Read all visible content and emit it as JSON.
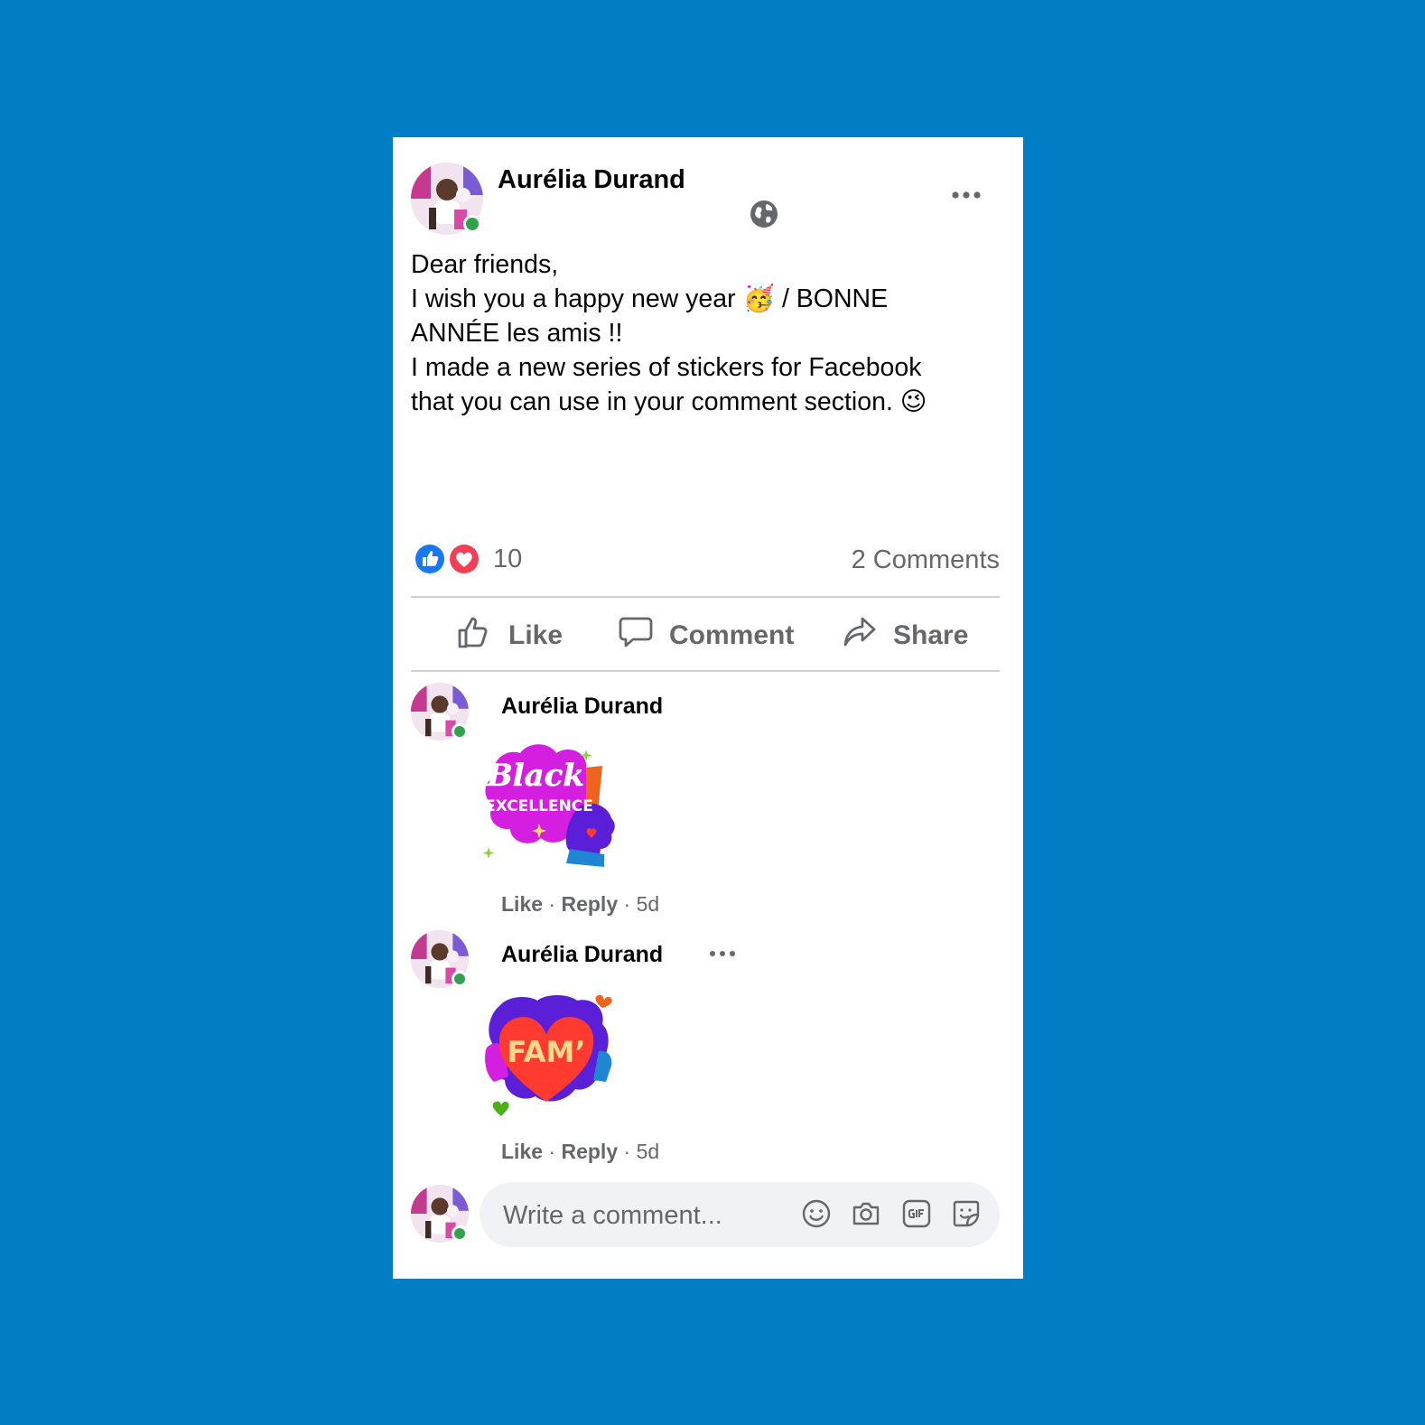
{
  "post": {
    "author": "Aurélia Durand",
    "text_lines": [
      "Dear friends,",
      "I wish you a happy new year 🥳 / BONNE",
      "ANNÉE les amis !!",
      "I made a new series of stickers for Facebook",
      "that you can use in your comment section. 😉"
    ],
    "reaction_count": "10",
    "comments_count": "2 Comments"
  },
  "actions": {
    "like": "Like",
    "comment": "Comment",
    "share": "Share"
  },
  "comments": [
    {
      "author": "Aurélia Durand",
      "sticker_text": [
        "Black",
        "EXCELLENCE"
      ],
      "like": "Like",
      "reply": "Reply",
      "sep": "·",
      "time": "5d"
    },
    {
      "author": "Aurélia Durand",
      "sticker_text": [
        "FAM’"
      ],
      "like": "Like",
      "reply": "Reply",
      "sep": "·",
      "time": "5d"
    }
  ],
  "composer": {
    "placeholder": "Write a comment..."
  },
  "colors": {
    "background": "#017dc5",
    "card": "#ffffff",
    "online": "#31a24c",
    "like_blue": "#1877f2",
    "love_red": "#f33e58"
  }
}
